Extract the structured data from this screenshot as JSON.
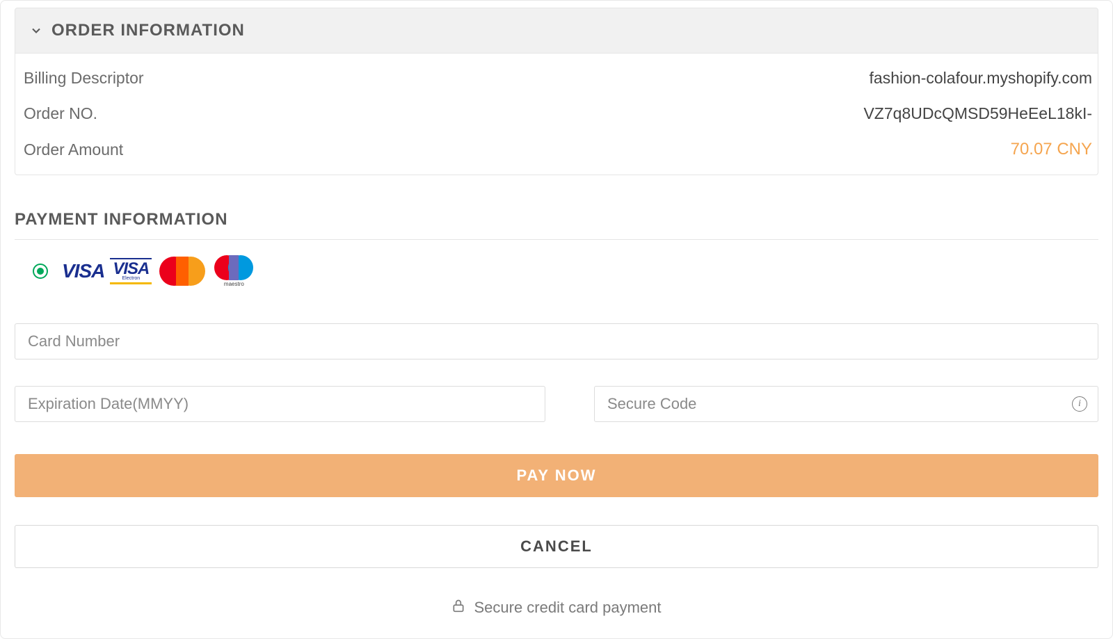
{
  "colors": {
    "accent": "#f5a54f",
    "primary_button": "#f2b176",
    "radio_active": "#00a85a"
  },
  "order_section": {
    "title": "ORDER INFORMATION",
    "rows": [
      {
        "label": "Billing Descriptor",
        "value": "fashion-colafour.myshopify.com"
      },
      {
        "label": "Order NO.",
        "value": "VZ7q8UDcQMSD59HeEeL18kI-"
      },
      {
        "label": "Order Amount",
        "value": "70.07 CNY"
      }
    ]
  },
  "payment_section": {
    "title": "PAYMENT INFORMATION",
    "card_brands": {
      "visa": "VISA",
      "visa_electron_sub": "Electron",
      "maestro_sub": "maestro"
    },
    "fields": {
      "card_number_placeholder": "Card Number",
      "expiration_placeholder": "Expiration Date(MMYY)",
      "secure_code_placeholder": "Secure Code"
    },
    "buttons": {
      "pay_now": "PAY NOW",
      "cancel": "CANCEL"
    },
    "footer_text": "Secure credit card payment"
  }
}
